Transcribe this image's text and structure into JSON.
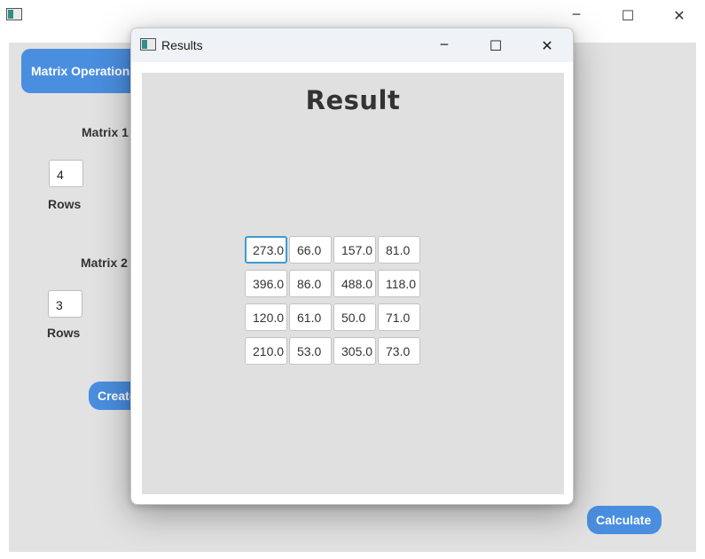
{
  "main": {
    "tab_label": "Matrix Operations",
    "matrix1_label": "Matrix 1",
    "matrix1_rows_value": "4",
    "matrix2_label": "Matrix 2",
    "matrix2_rows_value": "3",
    "rows_label": "Rows",
    "create_button": "Create",
    "calculate_button": "Calculate"
  },
  "dialog": {
    "title": "Results",
    "heading": "Result",
    "matrix": [
      [
        "273.0",
        "66.0",
        "157.0",
        "81.0"
      ],
      [
        "396.0",
        "86.0",
        "488.0",
        "118.0"
      ],
      [
        "120.0",
        "61.0",
        "50.0",
        "71.0"
      ],
      [
        "210.0",
        "53.0",
        "305.0",
        "73.0"
      ]
    ]
  },
  "window_controls": {
    "minimize": "─",
    "maximize": "☐",
    "close": "✕"
  },
  "colors": {
    "accent": "#4a8ee0",
    "focus": "#3e9bd1"
  }
}
